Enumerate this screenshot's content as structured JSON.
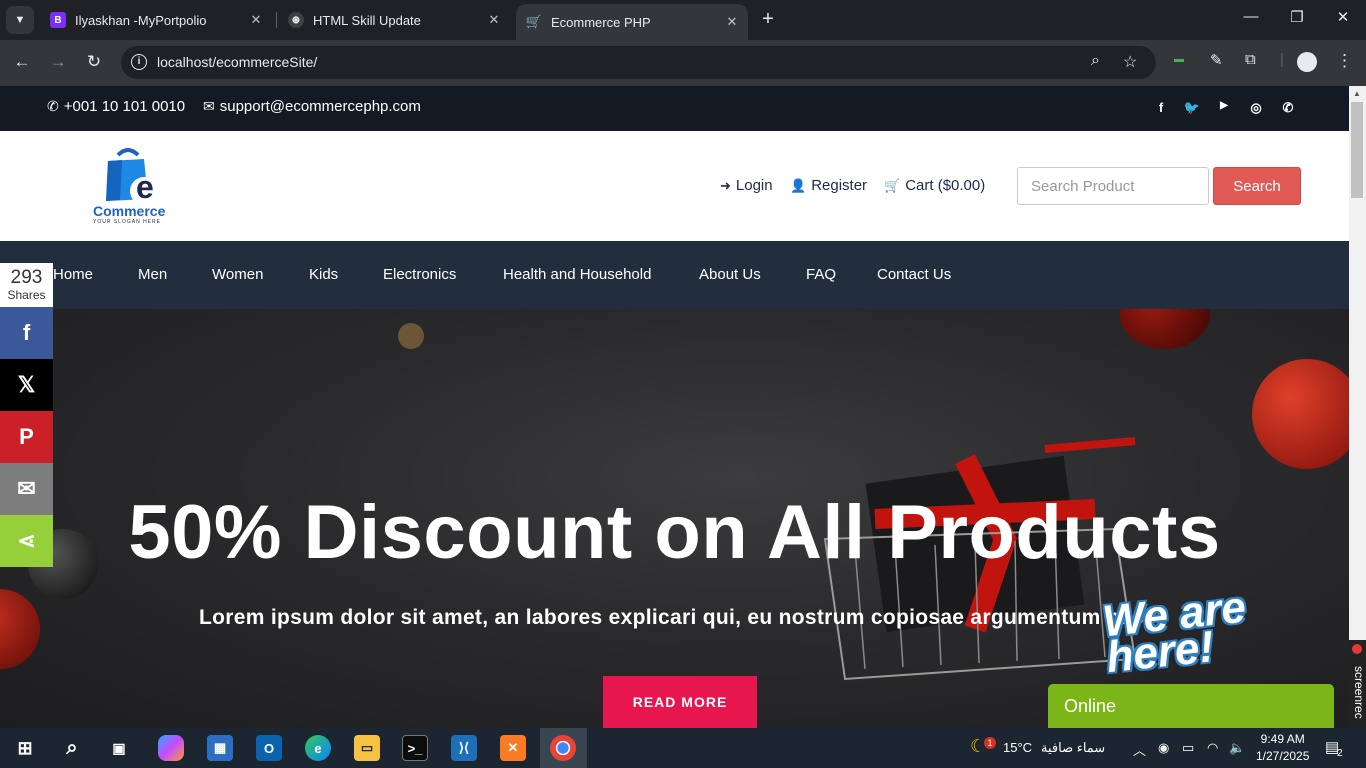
{
  "browser": {
    "tabs": [
      {
        "title": "Ilyaskhan -MyPortpolio",
        "favicon": "B",
        "favicon_color": "#7b2ff7",
        "active": false
      },
      {
        "title": "HTML Skill Update",
        "favicon": "⊛",
        "favicon_color": "#3c4043",
        "active": false
      },
      {
        "title": "Ecommerce PHP",
        "favicon": "cart-icon",
        "favicon_color": "#e8164e",
        "active": true
      }
    ],
    "url": "localhost/ecommerceSite/"
  },
  "topbar": {
    "phone": "+001 10 101 0010",
    "email": "support@ecommercephp.com",
    "social": [
      "facebook-icon",
      "twitter-icon",
      "youtube-icon",
      "instagram-icon",
      "whatsapp-icon"
    ]
  },
  "header": {
    "logo_word": "Commerce",
    "logo_letter": "e",
    "logo_slogan": "YOUR SLOGAN HERE",
    "login": "Login",
    "register": "Register",
    "cart": "Cart ($0.00)",
    "search_placeholder": "Search Product",
    "search_button": "Search"
  },
  "nav": [
    "Home",
    "Men",
    "Women",
    "Kids",
    "Electronics",
    "Health and Household",
    "About Us",
    "FAQ",
    "Contact Us"
  ],
  "hero": {
    "title": "50% Discount on All Products",
    "subtitle": "Lorem ipsum dolor sit amet, an labores explicari qui, eu nostrum copiosae argumentum has.",
    "button": "READ MORE"
  },
  "share": {
    "count": "293",
    "label": "Shares",
    "buttons": [
      {
        "name": "facebook",
        "glyph": "f",
        "color": "#3b5998"
      },
      {
        "name": "x",
        "glyph": "𝕏",
        "color": "#000000"
      },
      {
        "name": "pinterest",
        "glyph": "P",
        "color": "#cb2027"
      },
      {
        "name": "email",
        "glyph": "✉",
        "color": "#7d7d7d"
      },
      {
        "name": "share",
        "glyph": "⋖",
        "color": "#95d03a"
      }
    ]
  },
  "chat": {
    "badge": "We are here!",
    "status": "Online"
  },
  "screenrec": "screenrec",
  "taskbar": {
    "weather": "15°C",
    "weather_text": "سماء صافية",
    "weather_badge": "1",
    "time": "9:49 AM",
    "date": "1/27/2025",
    "notifications": "2"
  }
}
